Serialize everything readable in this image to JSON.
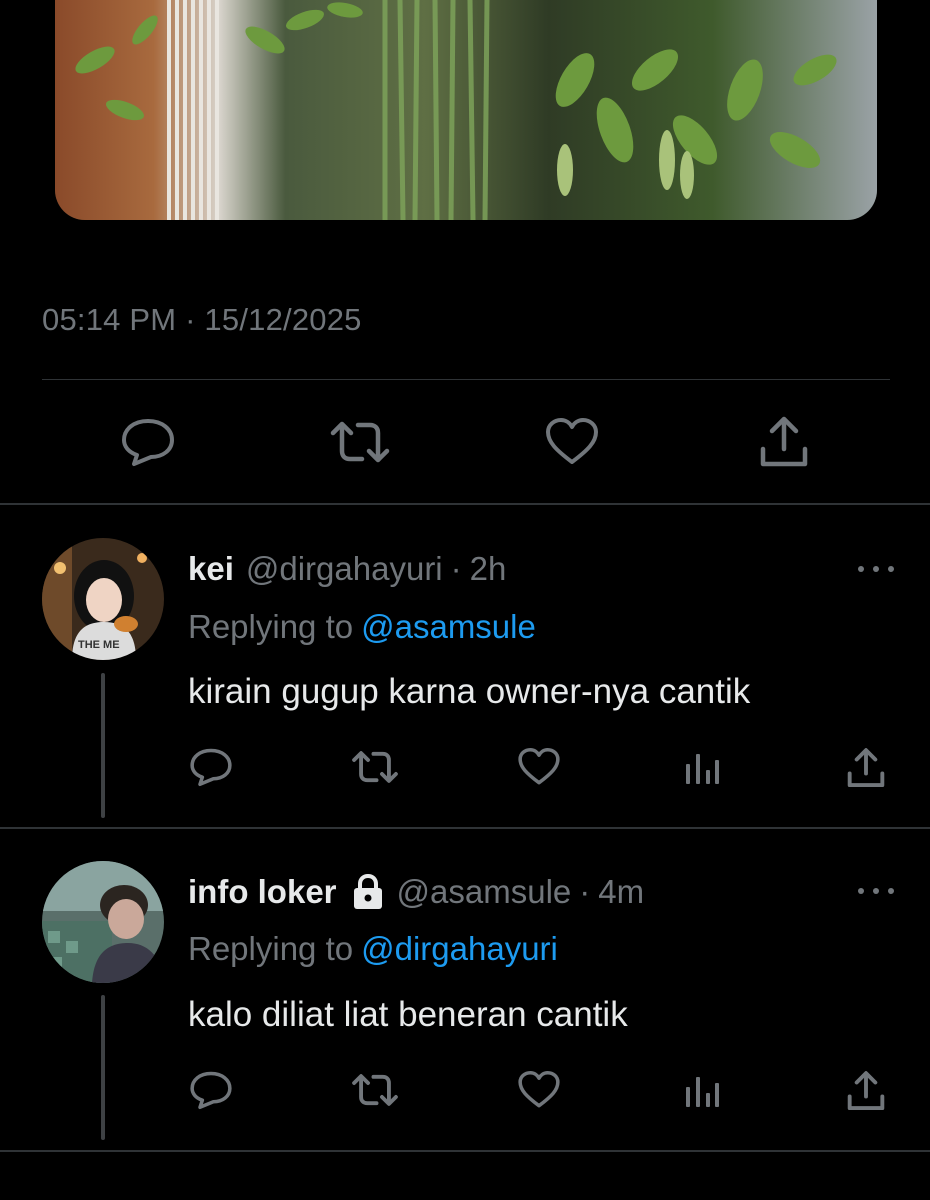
{
  "tweet": {
    "timestamp": "05:14 PM · 15/12/2025",
    "actions": [
      {
        "name": "reply-icon"
      },
      {
        "name": "retweet-icon"
      },
      {
        "name": "like-icon"
      },
      {
        "name": "share-icon"
      }
    ]
  },
  "replies": [
    {
      "name": "kei",
      "handle": "@dirgahayuri",
      "time": "2h",
      "replying_label": "Replying to",
      "replying_to": "@asamsule",
      "text": "kirain gugup karna owner-nya cantik",
      "avatar_icon": "avatar-photo",
      "locked": false
    },
    {
      "name": "info loker",
      "handle": "@asamsule",
      "time": "4m",
      "replying_label": "Replying to",
      "replying_to": "@dirgahayuri",
      "text": "kalo diliat liat beneran cantik",
      "avatar_icon": "avatar-photo",
      "locked": true
    }
  ],
  "colors": {
    "background": "#000000",
    "text_primary": "#e7e9ea",
    "text_secondary": "#71767b",
    "link": "#1d9bf0",
    "divider": "#2f3336"
  },
  "separator": "·"
}
